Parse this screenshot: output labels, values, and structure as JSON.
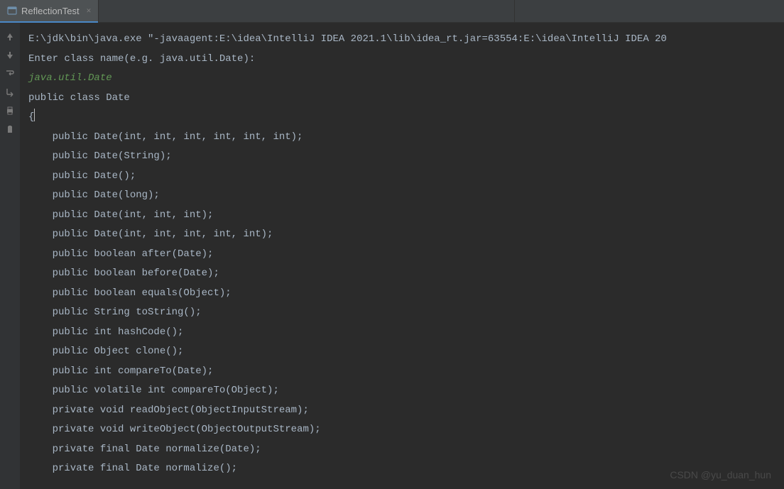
{
  "tab": {
    "title": "ReflectionTest"
  },
  "console": {
    "line1": "E:\\jdk\\bin\\java.exe \"-javaagent:E:\\idea\\IntelliJ IDEA 2021.1\\lib\\idea_rt.jar=63554:E:\\idea\\IntelliJ IDEA 20",
    "line2": "Enter class name(e.g. java.util.Date):",
    "userInput": "java.util.Date",
    "line4": "public class Date",
    "line5": "{",
    "line6": "    public Date(int, int, int, int, int, int);",
    "line7": "    public Date(String);",
    "line8": "    public Date();",
    "line9": "    public Date(long);",
    "line10": "    public Date(int, int, int);",
    "line11": "    public Date(int, int, int, int, int);",
    "line12": "",
    "line13": "    public boolean after(Date);",
    "line14": "    public boolean before(Date);",
    "line15": "    public boolean equals(Object);",
    "line16": "    public String toString();",
    "line17": "    public int hashCode();",
    "line18": "    public Object clone();",
    "line19": "    public int compareTo(Date);",
    "line20": "    public volatile int compareTo(Object);",
    "line21": "    private void readObject(ObjectInputStream);",
    "line22": "    private void writeObject(ObjectOutputStream);",
    "line23": "    private final Date normalize(Date);",
    "line24": "    private final Date normalize();"
  },
  "watermark": "CSDN @yu_duan_hun"
}
